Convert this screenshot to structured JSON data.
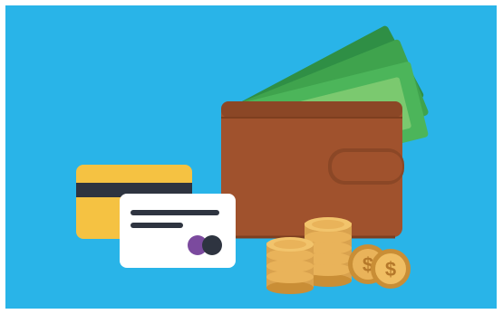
{
  "illustration": {
    "subject": "wallet-with-cash-cards-and-coins",
    "colors": {
      "background": "#29B4E8",
      "wallet": "#A0522D",
      "wallet_dark": "#7E3F1F",
      "cash": "#3FA34D",
      "cash_light": "#7BC96F",
      "card_yellow": "#F5C242",
      "card_white": "#FFFFFF",
      "stripe": "#2E3440",
      "coin": "#E9B35A",
      "coin_dark": "#C98E36",
      "dot_purple": "#7B4A9E"
    },
    "icons": [
      "wallet-icon",
      "banknote-icon",
      "credit-card-icon",
      "coin-stack-icon",
      "dollar-coin-icon"
    ]
  }
}
